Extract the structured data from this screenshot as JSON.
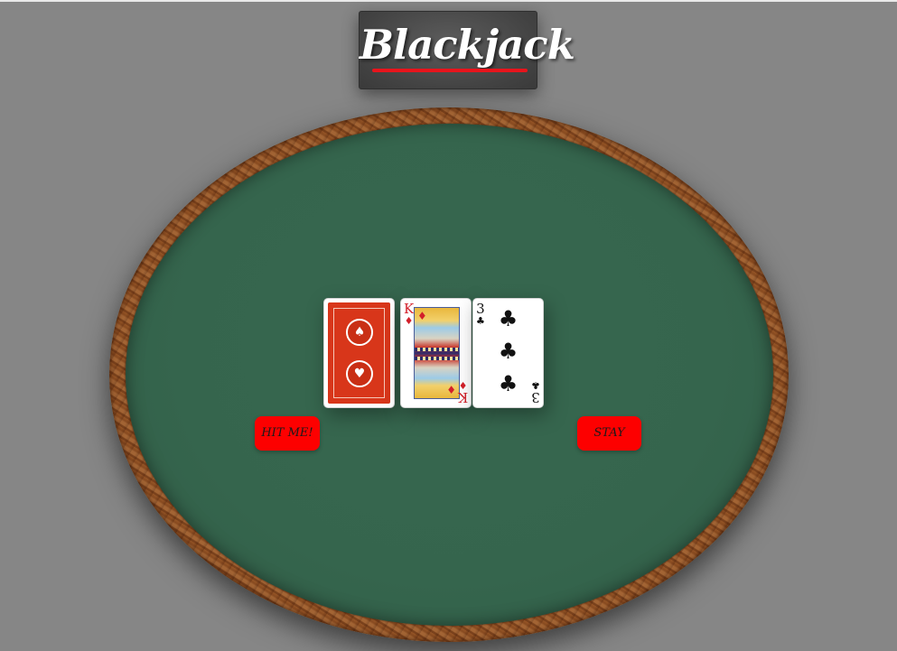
{
  "header": {
    "title": "Blackjack",
    "accent_color": "#e8141c"
  },
  "table": {
    "felt_color": "#35654d",
    "rim_color": "#9c5a2a"
  },
  "cards": [
    {
      "face_down": true,
      "back_color": "#d8361a",
      "icon": "card-back"
    },
    {
      "face_down": false,
      "rank": "K",
      "suit": "♦",
      "suit_name": "diamonds",
      "color": "red"
    },
    {
      "face_down": false,
      "rank": "3",
      "suit": "♣",
      "suit_name": "clubs",
      "color": "black"
    }
  ],
  "controls": {
    "hit_label": "HIT ME!",
    "stay_label": "STAY",
    "button_color": "#fd0000"
  }
}
